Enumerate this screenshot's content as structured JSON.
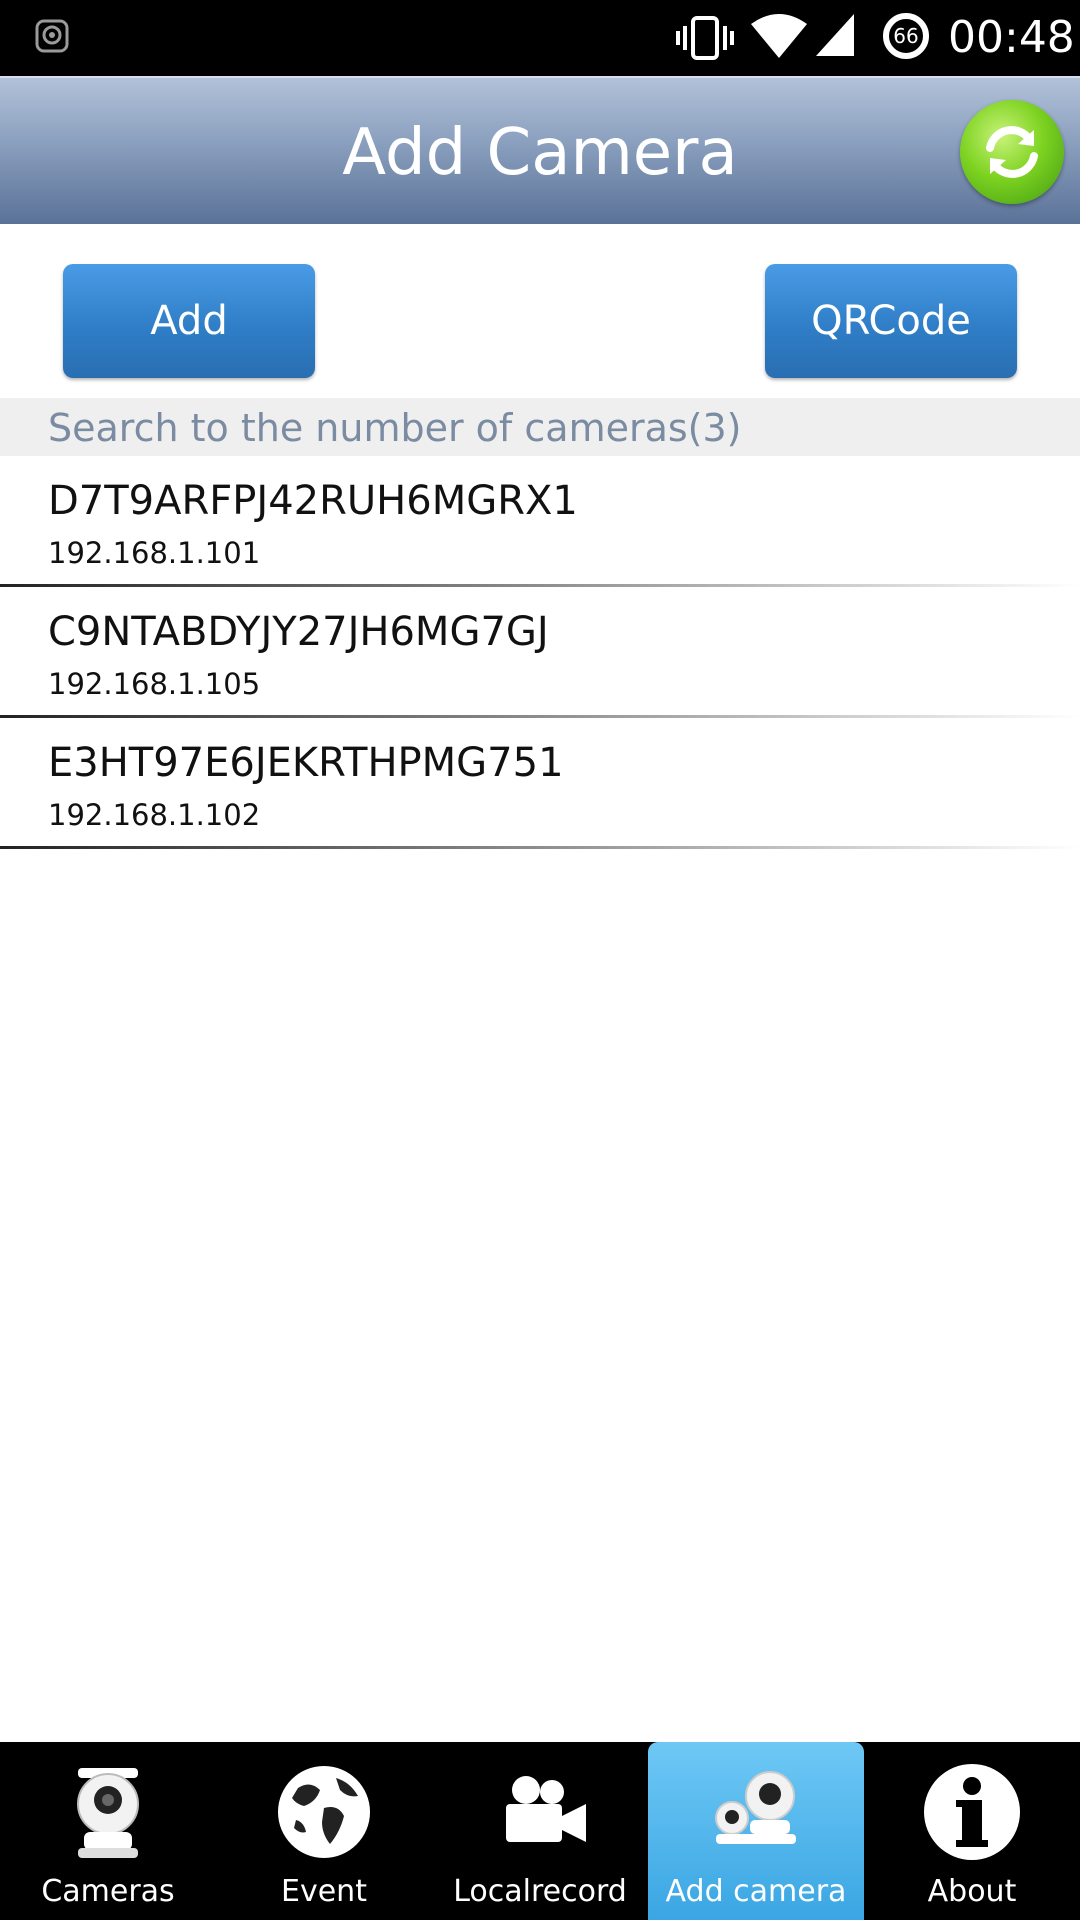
{
  "status_bar": {
    "time": "00:48",
    "battery_level": "66",
    "icons": [
      "screenshot-icon",
      "vibrate-icon",
      "wifi-icon",
      "signal-icon",
      "battery-icon"
    ]
  },
  "header": {
    "title": "Add Camera",
    "refresh_icon": "refresh-icon"
  },
  "actions": {
    "add_label": "Add",
    "qrcode_label": "QRCode"
  },
  "search_result": {
    "text": "Search to the number of cameras(3)"
  },
  "cameras": [
    {
      "id": "D7T9ARFPJ42RUH6MGRX1",
      "ip": "192.168.1.101"
    },
    {
      "id": "C9NTABDYJY27JH6MG7GJ",
      "ip": "192.168.1.105"
    },
    {
      "id": "E3HT97E6JEKRTHPMG751",
      "ip": "192.168.1.102"
    }
  ],
  "bottom_nav": [
    {
      "label": "Cameras",
      "icon": "camera-icon",
      "active": false
    },
    {
      "label": "Event",
      "icon": "globe-icon",
      "active": false
    },
    {
      "label": "Localrecord",
      "icon": "video-camera-icon",
      "active": false
    },
    {
      "label": "Add camera",
      "icon": "add-camera-icon",
      "active": true
    },
    {
      "label": "About",
      "icon": "info-icon",
      "active": false
    }
  ],
  "colors": {
    "header_gradient_top": "#b2c1d8",
    "header_gradient_bottom": "#5b7298",
    "button_blue": "#2f7ec7",
    "active_tab": "#3aa6e3",
    "count_text": "#7a8ba2"
  }
}
